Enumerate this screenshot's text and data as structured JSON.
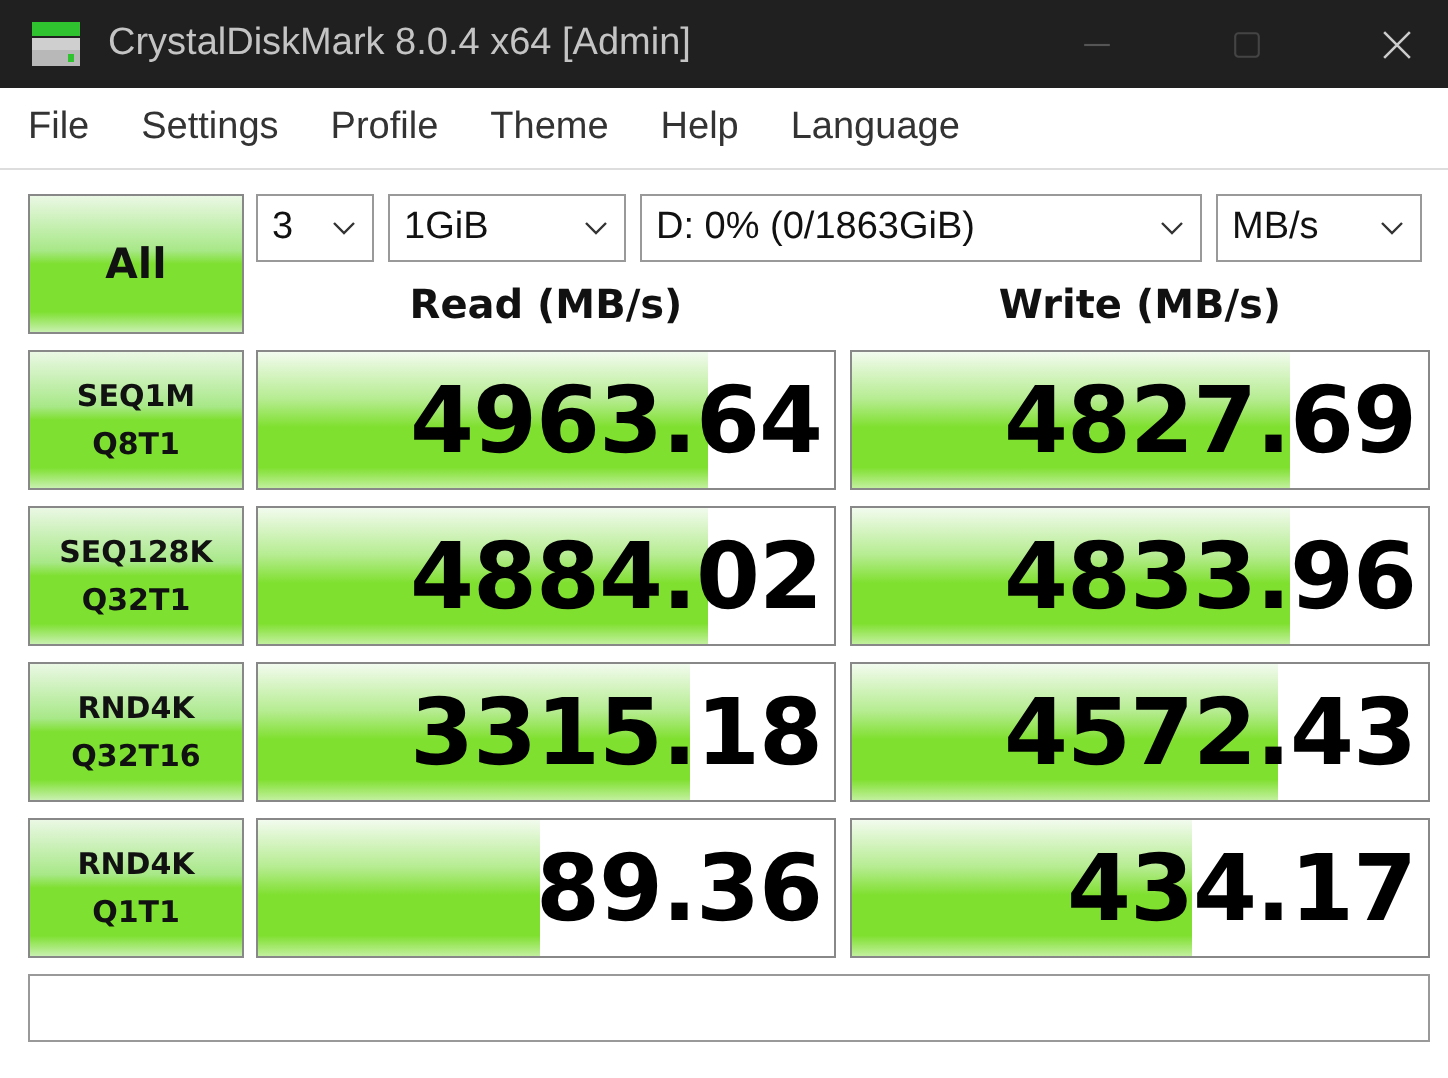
{
  "window": {
    "title": "CrystalDiskMark 8.0.4 x64 [Admin]"
  },
  "menu": [
    "File",
    "Settings",
    "Profile",
    "Theme",
    "Help",
    "Language"
  ],
  "all_button": "All",
  "selects": [
    {
      "value": "3"
    },
    {
      "value": "1GiB"
    },
    {
      "value": "D: 0% (0/1863GiB)"
    },
    {
      "value": "MB/s"
    }
  ],
  "columns": [
    "Read (MB/s)",
    "Write (MB/s)"
  ],
  "rows": [
    {
      "test": [
        "SEQ1M",
        "Q8T1"
      ],
      "read": {
        "value": "4963.64",
        "level": 0.78
      },
      "write": {
        "value": "4827.69",
        "level": 0.76
      }
    },
    {
      "test": [
        "SEQ128K",
        "Q32T1"
      ],
      "read": {
        "value": "4884.02",
        "level": 0.78
      },
      "write": {
        "value": "4833.96",
        "level": 0.76
      }
    },
    {
      "test": [
        "RND4K",
        "Q32T16"
      ],
      "read": {
        "value": "3315.18",
        "level": 0.75
      },
      "write": {
        "value": "4572.43",
        "level": 0.74
      }
    },
    {
      "test": [
        "RND4K",
        "Q1T1"
      ],
      "read": {
        "value": "89.36",
        "level": 0.49
      },
      "write": {
        "value": "434.17",
        "level": 0.59
      }
    }
  ]
}
